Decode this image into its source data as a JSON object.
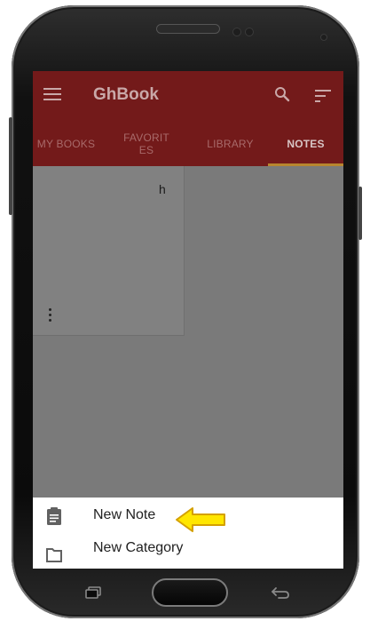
{
  "app": {
    "title": "GhBook"
  },
  "tabs": [
    {
      "label": "MY BOOKS",
      "active": false
    },
    {
      "label": "FAVORITES",
      "active": false
    },
    {
      "label": "LIBRARY",
      "active": false
    },
    {
      "label": "NOTES",
      "active": true
    }
  ],
  "notes": [
    {
      "text": "h"
    }
  ],
  "bottom_sheet": {
    "items": [
      {
        "label": "New Note",
        "icon": "clipboard-icon"
      },
      {
        "label": "New Category",
        "icon": "folder-icon"
      }
    ]
  },
  "colors": {
    "appbar": "#731a1a",
    "tab_indicator": "#b7862f",
    "scrim": "#7a7a7a",
    "arrow_fill": "#ffe600",
    "arrow_stroke": "#d4a000"
  },
  "icons": [
    "menu-icon",
    "search-icon",
    "sort-icon",
    "more-vert-icon",
    "recent-apps-icon",
    "home-button",
    "back-icon"
  ]
}
